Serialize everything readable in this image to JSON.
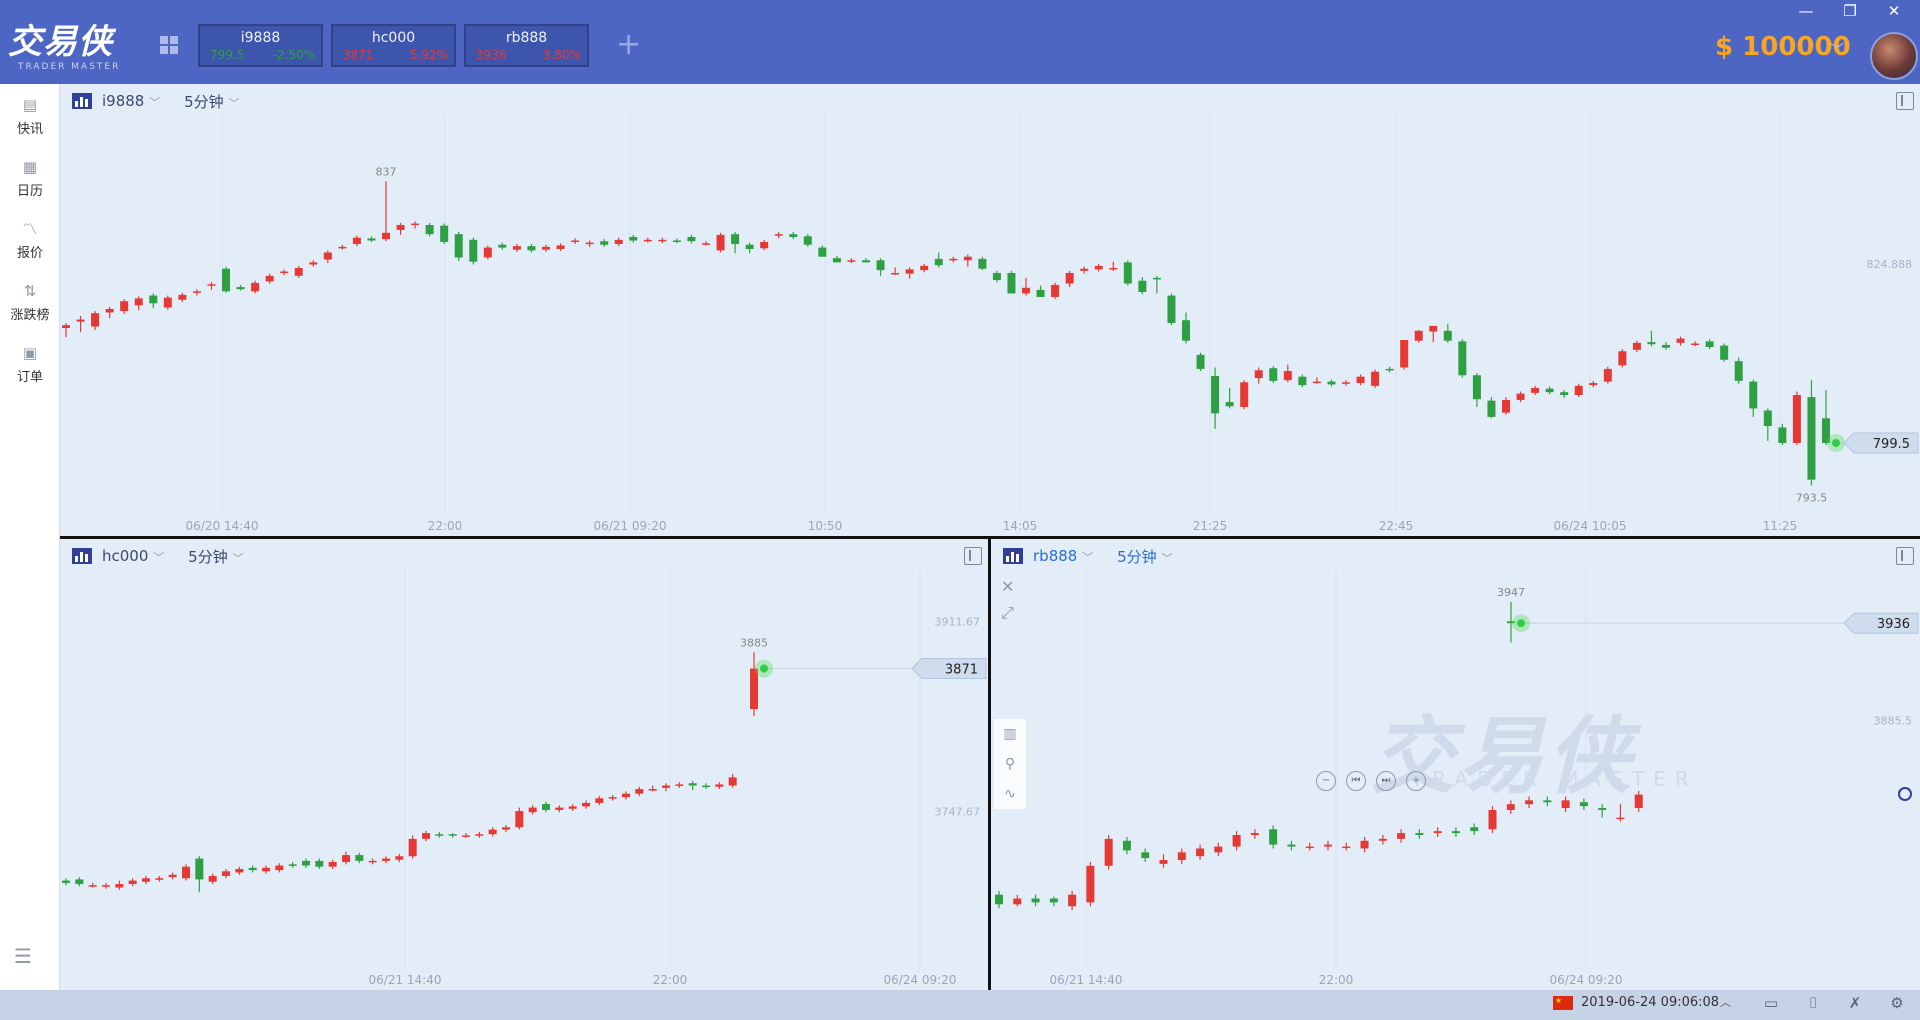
{
  "app": {
    "logo_cn": "交易侠",
    "logo_en": "TRADER MASTER"
  },
  "tabs": [
    {
      "symbol": "i9888",
      "price": "799.5",
      "change": "-2.50%",
      "color": "#2ea043"
    },
    {
      "symbol": "hc000",
      "price": "3871",
      "change": "5.92%",
      "color": "#e53935"
    },
    {
      "symbol": "rb888",
      "price": "3936",
      "change": "3.80%",
      "color": "#e53935"
    }
  ],
  "add_tab_icon": "plus-icon",
  "window_controls": {
    "minimize": "—",
    "restore": "❐",
    "close": "✕"
  },
  "account": {
    "balance": "$ 100000"
  },
  "sidebar": {
    "items": [
      {
        "label": "快讯",
        "icon": "news-icon",
        "glyph": "▤"
      },
      {
        "label": "日历",
        "icon": "calendar-icon",
        "glyph": "▦"
      },
      {
        "label": "报价",
        "icon": "quote-chart-icon",
        "glyph": "〽"
      },
      {
        "label": "涨跌榜",
        "icon": "sort-arrows-icon",
        "glyph": "⇅"
      },
      {
        "label": "订单",
        "icon": "order-icon",
        "glyph": "▣"
      }
    ],
    "menu_glyph": "☰"
  },
  "panels": {
    "i9888": {
      "symbol": "i9888",
      "timeframe": "5分钟",
      "chev": "﹀"
    },
    "hc000": {
      "symbol": "hc000",
      "timeframe": "5分钟",
      "chev": "﹀"
    },
    "rb888": {
      "symbol": "rb888",
      "timeframe": "5分钟",
      "chev": "﹀"
    }
  },
  "rb_tools": {
    "close": "✕",
    "expand": "⤢"
  },
  "rb_left_tools": [
    "▥",
    "⚲",
    "∿"
  ],
  "rb_nav": [
    "−",
    "⏮",
    "⏭",
    "+"
  ],
  "status": {
    "flag_glyph": "★",
    "datetime": "2019-06-24 09:06:08",
    "chev": "︿",
    "icons": [
      {
        "name": "window-icon",
        "glyph": "▭"
      },
      {
        "name": "camera-icon",
        "glyph": "⌷"
      },
      {
        "name": "mute-icon",
        "glyph": "✗"
      },
      {
        "name": "settings-icon",
        "glyph": "⚙"
      }
    ]
  },
  "colors": {
    "up": "#e53935",
    "down": "#2ea043",
    "accent": "#4e66c3",
    "balance": "#f6a623"
  },
  "chart_data": [
    {
      "symbol": "i9888",
      "type": "candlestick",
      "x_ticks": [
        "06/20 14:40",
        "22:00",
        "06/21 09:20",
        "10:50",
        "14:05",
        "21:25",
        "22:45",
        "06/24 10:05",
        "11:25"
      ],
      "y_labels": [
        "824.888"
      ],
      "y_range": [
        790,
        845
      ],
      "current_price": "799.5",
      "high_label": "837",
      "low_label": "793.5",
      "closes": [
        816.2,
        817.0,
        817.9,
        818.5,
        819.6,
        820.0,
        819.3,
        820.1,
        820.5,
        821.0,
        822.0,
        821.0,
        821.3,
        822.2,
        823.2,
        823.8,
        824.3,
        825.1,
        826.5,
        827.3,
        828.6,
        828.2,
        829.3,
        830.4,
        830.6,
        829.1,
        828.0,
        825.8,
        825.2,
        827.2,
        827.2,
        827.4,
        826.8,
        827.3,
        827.5,
        828.2,
        827.9,
        827.6,
        828.3,
        828.2,
        828.3,
        828.3,
        828.1,
        828.1,
        827.8,
        829.0,
        827.7,
        827.0,
        828.0,
        829.1,
        828.7,
        827.6,
        825.9,
        825.1,
        825.4,
        825.1,
        824.0,
        823.6,
        824.1,
        824.6,
        824.7,
        825.6,
        825.9,
        824.2,
        822.6,
        820.7,
        821.5,
        820.2,
        821.9,
        823.6,
        824.2,
        824.6,
        824.3,
        822.1,
        820.9,
        822.7,
        816.5,
        814.0,
        810.0,
        803.7,
        804.7,
        808.1,
        809.8,
        808.3,
        809.7,
        807.7,
        808.2,
        807.8,
        808.1,
        808.9,
        809.6,
        809.8,
        814.1,
        815.4,
        816.1,
        814.0,
        809.1,
        805.7,
        803.2,
        805.6,
        806.5,
        807.3,
        806.7,
        806.3,
        807.6,
        808.0,
        810.0,
        812.5,
        813.7,
        813.5,
        813.0,
        814.3,
        813.6,
        813.1,
        811.3,
        808.3,
        804.4,
        801.9,
        799.5,
        806.3,
        794.3,
        799.5
      ],
      "opens": [
        815.8,
        816.7,
        816.0,
        818.0,
        818.2,
        819.0,
        820.4,
        818.7,
        819.8,
        820.9,
        821.9,
        824.2,
        821.6,
        821.0,
        822.4,
        823.6,
        823.2,
        824.8,
        825.5,
        827.2,
        827.7,
        828.5,
        828.4,
        829.7,
        830.4,
        830.4,
        830.3,
        829.1,
        828.3,
        825.8,
        827.6,
        826.9,
        827.4,
        826.9,
        827.0,
        828.0,
        827.7,
        828.1,
        827.7,
        828.7,
        828.2,
        828.1,
        828.2,
        828.7,
        827.8,
        826.8,
        829.1,
        827.6,
        827.1,
        829.1,
        829.1,
        828.8,
        827.2,
        825.7,
        825.3,
        825.4,
        825.4,
        823.6,
        823.5,
        824.0,
        825.6,
        825.4,
        825.4,
        825.6,
        823.6,
        823.6,
        820.7,
        821.2,
        820.2,
        822.1,
        823.9,
        824.1,
        824.3,
        825.1,
        822.5,
        822.9,
        820.4,
        816.9,
        812.0,
        809.0,
        805.3,
        804.6,
        808.7,
        810.1,
        808.4,
        808.9,
        808.2,
        808.2,
        807.9,
        808.0,
        807.6,
        810.0,
        810.2,
        814.0,
        815.3,
        815.4,
        813.9,
        809.1,
        805.5,
        803.8,
        805.6,
        806.6,
        807.2,
        806.7,
        806.3,
        807.7,
        808.2,
        810.5,
        812.7,
        813.8,
        813.4,
        813.7,
        813.5,
        813.9,
        813.3,
        811.1,
        808.2,
        804.1,
        801.7,
        799.5,
        806.0,
        803.0
      ],
      "highs": [
        816.5,
        817.5,
        818.2,
        818.8,
        819.9,
        820.3,
        820.7,
        820.4,
        820.8,
        821.3,
        822.3,
        824.5,
        821.9,
        822.5,
        823.5,
        824.1,
        824.6,
        825.4,
        826.8,
        827.6,
        828.9,
        828.8,
        836.6,
        830.7,
        830.9,
        830.7,
        830.6,
        829.4,
        828.6,
        827.5,
        827.9,
        827.7,
        827.7,
        827.6,
        827.8,
        828.5,
        828.2,
        828.4,
        828.6,
        829.0,
        828.6,
        828.6,
        828.5,
        829.0,
        828.1,
        829.3,
        829.4,
        827.9,
        828.3,
        829.4,
        829.4,
        829.1,
        827.5,
        826.0,
        825.7,
        825.7,
        825.7,
        824.4,
        824.4,
        824.9,
        826.5,
        825.9,
        826.2,
        825.9,
        823.9,
        823.9,
        822.9,
        821.8,
        822.2,
        823.9,
        824.5,
        824.9,
        825.2,
        825.4,
        823.0,
        823.2,
        820.7,
        818.0,
        812.3,
        810.2,
        807.3,
        808.4,
        810.2,
        810.4,
        810.6,
        809.2,
        808.8,
        808.5,
        808.4,
        809.2,
        809.9,
        810.3,
        810.5,
        815.5,
        815.6,
        816.4,
        814.2,
        809.4,
        806.0,
        806.0,
        806.8,
        807.6,
        807.5,
        807.0,
        807.9,
        808.3,
        810.3,
        812.8,
        814.0,
        815.4,
        813.8,
        814.6,
        813.9,
        814.2,
        813.6,
        811.6,
        808.5,
        804.4,
        802.2,
        806.8,
        808.4,
        807.0
      ],
      "lows": [
        814.5,
        815.2,
        815.5,
        817.2,
        817.8,
        818.3,
        818.6,
        818.4,
        819.5,
        820.4,
        821.2,
        820.8,
        821.1,
        820.7,
        822.1,
        823.3,
        822.9,
        824.5,
        825.0,
        826.9,
        827.4,
        828.0,
        828.1,
        829.0,
        829.9,
        828.8,
        827.7,
        825.3,
        824.8,
        825.5,
        826.9,
        826.6,
        826.5,
        826.6,
        826.7,
        827.7,
        827.3,
        827.3,
        827.4,
        827.9,
        827.9,
        827.8,
        827.8,
        827.8,
        827.5,
        826.5,
        826.4,
        826.4,
        826.8,
        828.5,
        828.4,
        827.3,
        826.9,
        825.4,
        825.0,
        825.1,
        823.2,
        823.3,
        822.8,
        823.7,
        824.4,
        825.1,
        824.5,
        824.0,
        822.3,
        822.3,
        820.4,
        820.2,
        819.9,
        821.6,
        823.5,
        823.8,
        823.9,
        821.8,
        820.6,
        820.7,
        816.2,
        813.6,
        809.7,
        801.5,
        804.4,
        804.3,
        807.9,
        808.0,
        808.1,
        807.4,
        807.9,
        807.5,
        807.6,
        807.7,
        807.3,
        809.5,
        809.9,
        813.7,
        813.8,
        813.7,
        808.8,
        804.6,
        803.0,
        803.5,
        805.3,
        806.3,
        806.4,
        805.9,
        806.0,
        807.4,
        807.9,
        810.2,
        812.4,
        813.2,
        812.7,
        813.3,
        813.2,
        812.8,
        811.0,
        807.9,
        803.2,
        799.8,
        799.2,
        799.2,
        793.5,
        799.2
      ]
    },
    {
      "symbol": "hc000",
      "type": "candlestick",
      "x_ticks": [
        "06/21 14:40",
        "22:00",
        "06/24 09:20"
      ],
      "y_labels": [
        "3911.67",
        "3747.67"
      ],
      "y_range": [
        3616,
        3950
      ],
      "current_price": "3871",
      "high_label": "3885",
      "closes": [
        3686,
        3685,
        3684,
        3684,
        3685,
        3688,
        3690,
        3690,
        3693,
        3700,
        3689,
        3692,
        3696,
        3698,
        3697,
        3699,
        3701,
        3701,
        3701,
        3700,
        3704,
        3710,
        3705,
        3705,
        3707,
        3709,
        3724,
        3729,
        3727,
        3727,
        3727,
        3728,
        3732,
        3734,
        3748,
        3751,
        3749,
        3751,
        3752,
        3755,
        3759,
        3760,
        3763,
        3767,
        3767,
        3770,
        3771,
        3770,
        3769,
        3771,
        3777,
        3871
      ],
      "opens": [
        3688,
        3689,
        3684,
        3683,
        3682,
        3685,
        3687,
        3690,
        3691,
        3690,
        3707,
        3687,
        3692,
        3695,
        3699,
        3696,
        3697,
        3702,
        3705,
        3705,
        3700,
        3704,
        3710,
        3704,
        3705,
        3706,
        3709,
        3724,
        3728,
        3728,
        3727,
        3727,
        3728,
        3732,
        3734,
        3747,
        3754,
        3749,
        3750,
        3752,
        3755,
        3759,
        3760,
        3763,
        3767,
        3768,
        3770,
        3772,
        3770,
        3769,
        3770,
        3836
      ],
      "highs": [
        3690,
        3691,
        3686,
        3686,
        3688,
        3690,
        3692,
        3692,
        3695,
        3702,
        3709,
        3694,
        3698,
        3700,
        3701,
        3701,
        3703,
        3704,
        3707,
        3707,
        3706,
        3713,
        3712,
        3707,
        3709,
        3711,
        3727,
        3731,
        3730,
        3729,
        3729,
        3730,
        3734,
        3736,
        3751,
        3753,
        3756,
        3753,
        3754,
        3757,
        3761,
        3762,
        3765,
        3769,
        3770,
        3772,
        3773,
        3774,
        3772,
        3773,
        3780,
        3885
      ],
      "lows": [
        3684,
        3683,
        3682,
        3681,
        3680,
        3683,
        3685,
        3687,
        3689,
        3688,
        3678,
        3685,
        3690,
        3693,
        3695,
        3694,
        3695,
        3699,
        3699,
        3698,
        3698,
        3702,
        3703,
        3702,
        3703,
        3704,
        3707,
        3722,
        3725,
        3725,
        3725,
        3725,
        3726,
        3730,
        3732,
        3745,
        3747,
        3747,
        3748,
        3750,
        3753,
        3757,
        3758,
        3761,
        3765,
        3765,
        3768,
        3766,
        3767,
        3767,
        3768,
        3830
      ]
    },
    {
      "symbol": "rb888",
      "type": "candlestick",
      "x_ticks": [
        "06/21 14:40",
        "22:00",
        "06/24 09:20"
      ],
      "y_labels": [
        "3885.5"
      ],
      "y_range": [
        3759,
        3960
      ],
      "current_price": "3936",
      "high_label": "3947",
      "closes": [
        3790,
        3793,
        3791,
        3791,
        3795,
        3810,
        3824,
        3818,
        3814,
        3813,
        3817,
        3819,
        3820,
        3826,
        3827,
        3821,
        3820,
        3820,
        3821,
        3820,
        3823,
        3824,
        3827,
        3826,
        3828,
        3827,
        3828,
        3839,
        3842,
        3844,
        3843,
        3844,
        3841,
        3839,
        3835,
        3847,
        3936
      ],
      "opens": [
        3795,
        3790,
        3793,
        3793,
        3789,
        3791,
        3810,
        3823,
        3817,
        3811,
        3813,
        3815,
        3817,
        3820,
        3826,
        3829,
        3821,
        3820,
        3820,
        3820,
        3819,
        3823,
        3824,
        3827,
        3827,
        3828,
        3830,
        3829,
        3839,
        3842,
        3844,
        3840,
        3843,
        3840,
        3835,
        3840,
        3937
      ],
      "highs": [
        3797,
        3795,
        3795,
        3794,
        3797,
        3812,
        3826,
        3825,
        3819,
        3816,
        3819,
        3821,
        3822,
        3828,
        3829,
        3831,
        3823,
        3822,
        3823,
        3822,
        3825,
        3826,
        3829,
        3829,
        3830,
        3830,
        3832,
        3841,
        3844,
        3846,
        3846,
        3846,
        3845,
        3842,
        3842,
        3849,
        3947
      ],
      "lows": [
        3788,
        3789,
        3789,
        3789,
        3787,
        3789,
        3808,
        3816,
        3812,
        3809,
        3811,
        3813,
        3815,
        3818,
        3824,
        3819,
        3818,
        3818,
        3818,
        3818,
        3817,
        3821,
        3822,
        3824,
        3825,
        3825,
        3826,
        3827,
        3837,
        3840,
        3841,
        3838,
        3839,
        3835,
        3833,
        3838,
        3926
      ]
    }
  ]
}
